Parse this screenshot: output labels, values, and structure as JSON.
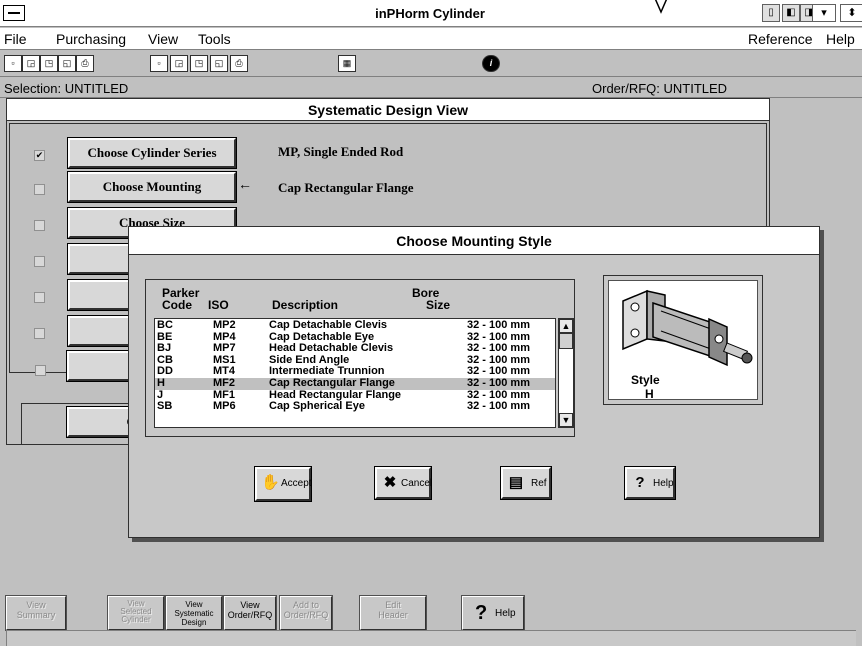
{
  "window": {
    "title": "inPHorm Cylinder"
  },
  "menu": {
    "file": "File",
    "purchasing": "Purchasing",
    "view": "View",
    "tools": "Tools",
    "reference": "Reference",
    "help": "Help"
  },
  "status": {
    "selection": "Selection: UNTITLED",
    "order": "Order/RFQ: UNTITLED"
  },
  "main": {
    "header": "Systematic Design View",
    "steps": [
      {
        "label": "Choose Cylinder Series",
        "value": "MP, Single Ended Rod",
        "checked": true
      },
      {
        "label": "Choose Mounting",
        "value": "Cap Rectangular Flange",
        "checked": false
      },
      {
        "label": "Choose Size",
        "value": "",
        "checked": false
      },
      {
        "label": "Choo",
        "value": "",
        "checked": false
      },
      {
        "label": "Ch",
        "value": "",
        "checked": false
      },
      {
        "label": "Choose",
        "value": "",
        "checked": false
      },
      {
        "label": "Choos",
        "value": "",
        "checked": false
      }
    ],
    "custom_button": "Custome"
  },
  "dialog": {
    "title": "Choose Mounting Style",
    "columns": {
      "parker": "Parker",
      "code": "Code",
      "iso": "ISO",
      "description": "Description",
      "bore": "Bore",
      "size": "Size"
    },
    "rows": [
      {
        "code": "BC",
        "iso": "MP2",
        "description": "Cap Detachable Clevis",
        "size": "32 - 100 mm"
      },
      {
        "code": "BE",
        "iso": "MP4",
        "description": "Cap Detachable Eye",
        "size": "32 - 100 mm"
      },
      {
        "code": "BJ",
        "iso": "MP7",
        "description": "Head Detachable Clevis",
        "size": "32 - 100 mm"
      },
      {
        "code": "CB",
        "iso": "MS1",
        "description": "Side End Angle",
        "size": "32 - 100 mm"
      },
      {
        "code": "DD",
        "iso": "MT4",
        "description": "Intermediate Trunnion",
        "size": "32 - 100 mm"
      },
      {
        "code": "H",
        "iso": "MF2",
        "description": "Cap Rectangular Flange",
        "size": "32 - 100 mm",
        "selected": true
      },
      {
        "code": "J",
        "iso": "MF1",
        "description": "Head Rectangular Flange",
        "size": "32 - 100 mm"
      },
      {
        "code": "SB",
        "iso": "MP6",
        "description": "Cap Spherical Eye",
        "size": "32 - 100 mm"
      }
    ],
    "preview": {
      "style_label": "Style",
      "style_value": "H"
    },
    "buttons": {
      "accept": "Accept",
      "cancel": "Cancel",
      "ref": "Ref",
      "help": "Help"
    }
  },
  "bottom": {
    "view_summary": [
      "View",
      "Summary"
    ],
    "view_selected": [
      "View",
      "Selected",
      "Cylinder"
    ],
    "view_systematic": [
      "View",
      "Systematic",
      "Design"
    ],
    "view_order": [
      "View",
      "Order/RFQ"
    ],
    "add_to": [
      "Add to",
      "Order/RFQ"
    ],
    "edit_header": [
      "Edit",
      "Header"
    ],
    "help": "Help"
  }
}
